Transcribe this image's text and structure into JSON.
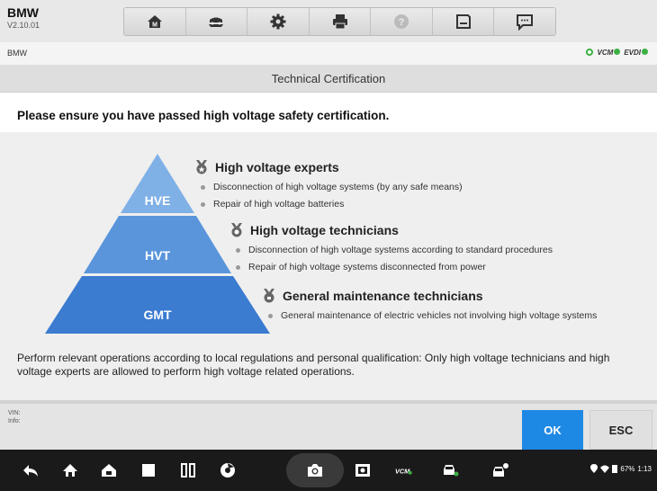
{
  "header": {
    "brand": "BMW",
    "version": "V2.10.01",
    "toolbar": [
      {
        "icon": "home-icon"
      },
      {
        "icon": "vehicle-swap-icon"
      },
      {
        "icon": "settings-icon"
      },
      {
        "icon": "print-icon"
      },
      {
        "icon": "help-icon"
      },
      {
        "icon": "save-icon"
      },
      {
        "icon": "message-icon"
      }
    ]
  },
  "subbar": {
    "path": "BMW",
    "vcm": "VCM",
    "evdi": "EVDI"
  },
  "title": "Technical Certification",
  "instruction": "Please ensure you have passed high voltage safety certification.",
  "pyramid": {
    "levels": [
      "HVE",
      "HVT",
      "GMT"
    ],
    "colors": [
      "#7fb0e6",
      "#5a95dc",
      "#3b7bd0"
    ]
  },
  "groups": [
    {
      "title": "High voltage experts",
      "items": [
        "Disconnection of high voltage systems (by any safe means)",
        "Repair of high voltage batteries"
      ]
    },
    {
      "title": "High voltage technicians",
      "items": [
        "Disconnection of high voltage systems according to standard procedures",
        "Repair of high voltage systems disconnected from power"
      ]
    },
    {
      "title": "General maintenance technicians",
      "items": [
        "General maintenance of electric vehicles not involving high voltage systems"
      ]
    }
  ],
  "note": "Perform relevant operations according to local regulations and personal qualification: Only high voltage technicians and high voltage experts are allowed to perform high voltage related operations.",
  "footer": {
    "vin_label": "VIN:",
    "info_label": "Info:",
    "ok": "OK",
    "esc": "ESC"
  },
  "navbar": {
    "vcm": "VCM",
    "status": "67%",
    "time": "1:13"
  }
}
